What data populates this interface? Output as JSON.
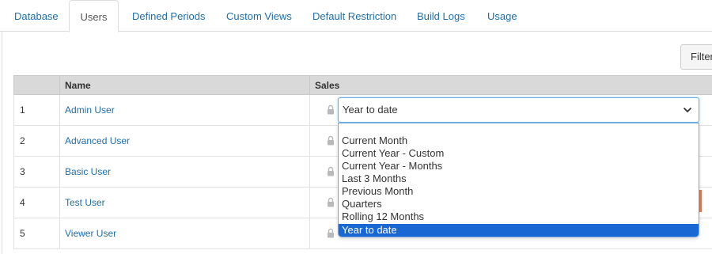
{
  "tabs": [
    {
      "label": "Database"
    },
    {
      "label": "Users"
    },
    {
      "label": "Defined Periods"
    },
    {
      "label": "Custom Views"
    },
    {
      "label": "Default Restriction"
    },
    {
      "label": "Build Logs"
    },
    {
      "label": "Usage"
    }
  ],
  "active_tab": "Users",
  "filter_button": {
    "label": "Filter"
  },
  "table": {
    "columns": [
      "",
      "Name",
      "Sales"
    ],
    "rows": [
      {
        "num": "1",
        "name": "Admin User"
      },
      {
        "num": "2",
        "name": "Advanced User"
      },
      {
        "num": "3",
        "name": "Basic User"
      },
      {
        "num": "4",
        "name": "Test User"
      },
      {
        "num": "5",
        "name": "Viewer User"
      }
    ]
  },
  "sales_select": {
    "value": "Year to date",
    "options": [
      {
        "label": ""
      },
      {
        "label": "Current Month"
      },
      {
        "label": "Current Year - Custom"
      },
      {
        "label": "Current Year - Months"
      },
      {
        "label": "Last 3 Months"
      },
      {
        "label": "Previous Month"
      },
      {
        "label": "Quarters"
      },
      {
        "label": "Rolling 12 Months"
      },
      {
        "label": "Year to date"
      }
    ],
    "selected_index": 8
  },
  "icons": {
    "row_lock": "lock-icon",
    "select_chevron": "chevron-down-icon"
  },
  "colors": {
    "link": "#1f6fa6",
    "header_bg": "#d9d9d9",
    "option_selected_bg": "#1967d2",
    "focus_border": "#66afe9"
  }
}
